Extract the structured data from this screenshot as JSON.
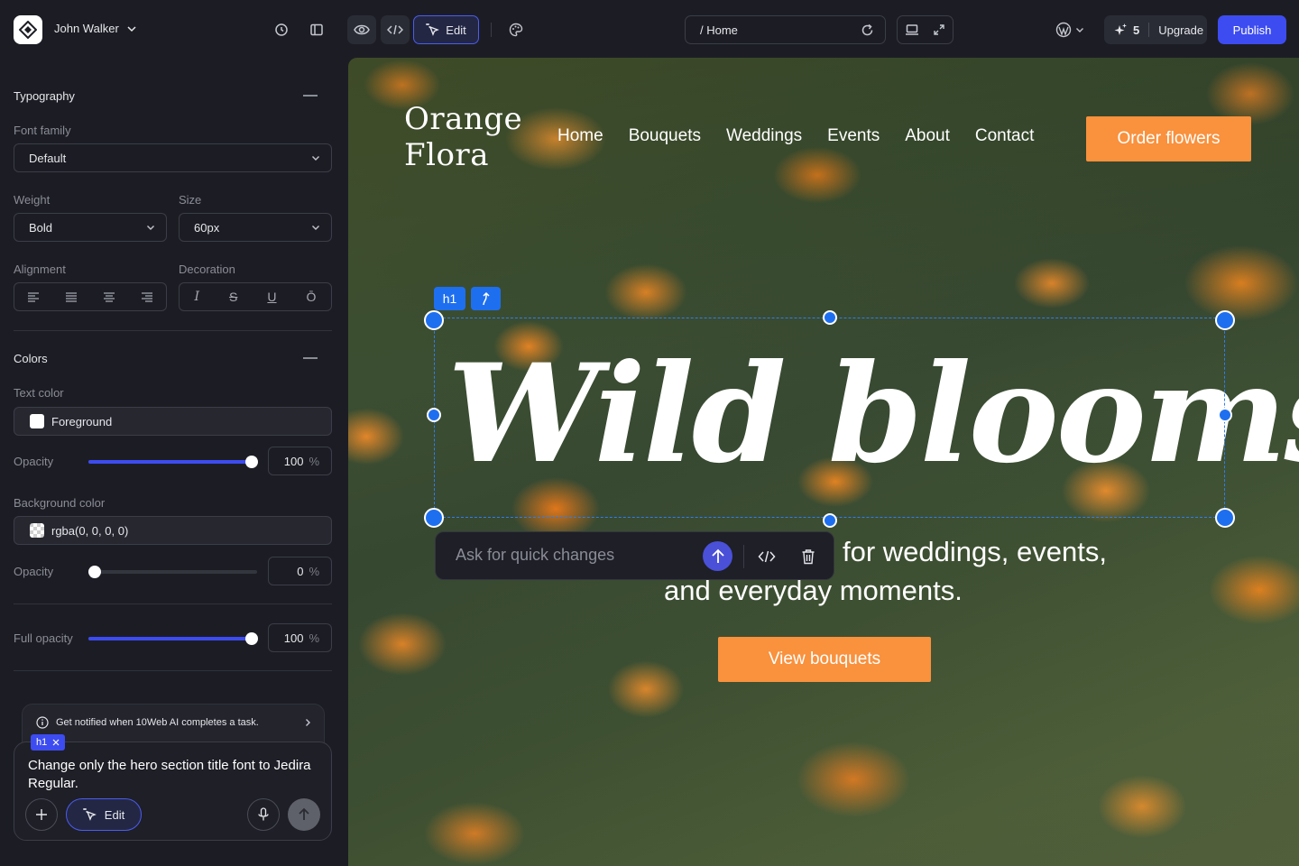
{
  "colors": {
    "accent": "#3d4cf0",
    "selection": "#1e6ff0",
    "cta": "#f9913d",
    "panel_bg": "#1c1d24"
  },
  "topbar": {
    "user_name": "John Walker",
    "edit_label": "Edit",
    "url_path": "/ Home",
    "credits_count": "5",
    "upgrade_label": "Upgrade",
    "publish_label": "Publish",
    "icons": [
      "history-icon",
      "sidebar-toggle-icon",
      "preview-eye-icon",
      "code-icon",
      "edit-cursor-icon",
      "palette-icon",
      "refresh-icon",
      "desktop-icon",
      "expand-icon",
      "wordpress-icon",
      "sparkle-icon"
    ]
  },
  "panel": {
    "typography": {
      "title": "Typography",
      "font_family_label": "Font family",
      "font_family_value": "Default",
      "weight_label": "Weight",
      "weight_value": "Bold",
      "size_label": "Size",
      "size_value": "60px",
      "alignment_label": "Alignment",
      "decoration_label": "Decoration",
      "decoration_options": [
        "I",
        "S",
        "U",
        "Ō"
      ]
    },
    "colors": {
      "title": "Colors",
      "text_color_label": "Text color",
      "text_color_value": "Foreground",
      "text_opacity_label": "Opacity",
      "text_opacity_value": "100",
      "text_opacity_pct": 100,
      "background_color_label": "Background color",
      "background_color_value": "rgba(0, 0, 0, 0)",
      "bg_opacity_label": "Opacity",
      "bg_opacity_value": "0",
      "bg_opacity_pct": 0,
      "full_opacity_label": "Full opacity",
      "full_opacity_value": "100",
      "full_opacity_pct": 100,
      "unit": "%"
    },
    "notify_text": "Get notified when 10Web AI completes a task.",
    "composer": {
      "tag": "h1",
      "prompt": "Change only the hero section title font to Jedira Regular.",
      "edit_label": "Edit"
    }
  },
  "site": {
    "brand_line1": "Orange",
    "brand_line2": "Flora",
    "nav": [
      "Home",
      "Bouquets",
      "Weddings",
      "Events",
      "About",
      "Contact"
    ],
    "order_label": "Order flowers",
    "hero_title": "Wild blooms",
    "selected_tag": "h1",
    "quick_placeholder": "Ask for quick changes",
    "subtitle_line1": "for weddings, events,",
    "subtitle_line2": "and everyday moments.",
    "view_label": "View bouquets"
  }
}
